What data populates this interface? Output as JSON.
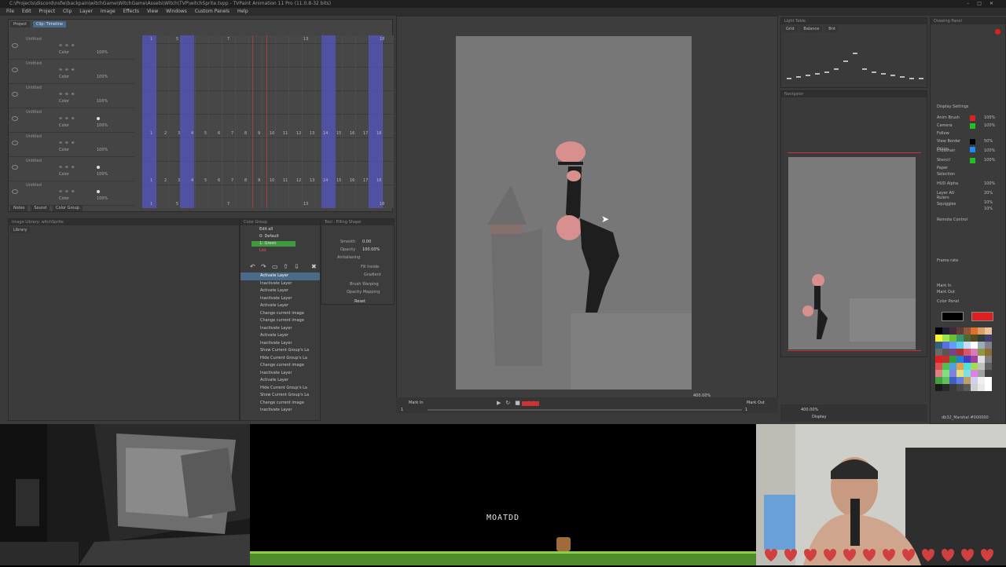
{
  "app": {
    "title": "C:\\Projects\\discord\\nsfw\\backpain\\witchGame\\WitchGame\\Assets\\Witch\\TVP\\witchSprite.tvpp - TVPaint Animation 11 Pro (11.0.8-32 bits)",
    "menu": [
      "File",
      "Edit",
      "Project",
      "Clip",
      "Layer",
      "Image",
      "Effects",
      "View",
      "Windows",
      "Custom Panels",
      "Help"
    ]
  },
  "timeline": {
    "tabs": [
      "Project",
      "Clip: Timeline"
    ],
    "layers": [
      {
        "name": "Untitled",
        "tool": "∞ ∞ ∞",
        "color": "Color",
        "opacity": "100%"
      },
      {
        "name": "Untitled",
        "tool": "∞ ∞ ∞",
        "color": "Color",
        "opacity": "100%"
      },
      {
        "name": "Untitled",
        "tool": "∞ ∞ ∞",
        "color": "Color",
        "opacity": "100%"
      },
      {
        "name": "Untitled",
        "tool": "∞ ∞ ∞",
        "color": "Color",
        "opacity": "100%"
      },
      {
        "name": "Untitled",
        "tool": "∞ ∞ ∞",
        "color": "Color",
        "opacity": "100%"
      },
      {
        "name": "Untitled",
        "tool": "∞ ∞ ∞",
        "color": "Color",
        "opacity": "100%"
      },
      {
        "name": "Untitled",
        "tool": "∞ ∞ ∞",
        "color": "Color",
        "opacity": "100%"
      }
    ],
    "ruler_top": [
      "1",
      "5",
      "7",
      "13",
      "18"
    ],
    "ruler_row": [
      "1",
      "2",
      "3",
      "4",
      "5",
      "6",
      "7",
      "8",
      "9",
      "10",
      "11",
      "12",
      "13",
      "14",
      "15",
      "16",
      "17",
      "18"
    ],
    "bottom_tabs": [
      "Notes",
      "Sound",
      "Color Group"
    ]
  },
  "library": {
    "tabs": [
      "Library",
      "Image Library: witchSprite"
    ]
  },
  "color_group": {
    "header": "Color Group",
    "items": [
      "Edit all",
      "0: Default",
      "1: Green",
      "List"
    ]
  },
  "history": {
    "items": [
      "Activate Layer",
      "Inactivate Layer",
      "Activate Layer",
      "Inactivate Layer",
      "Activate Layer",
      "Change current image",
      "Change current image",
      "Inactivate Layer",
      "Activate Layer",
      "Inactivate Layer",
      "Show Current Group's La",
      "Hide Current Group's La",
      "Change current image",
      "Inactivate Layer",
      "Activate Layer",
      "Hide Current Group's La",
      "Show Current Group's La",
      "Change current image",
      "Inactivate Layer"
    ]
  },
  "tool_options": {
    "header": "Tool : Filling Shape",
    "rows": [
      "Smooth",
      "Opacity",
      "Antialiasing",
      "Fill Inside",
      "Gradient",
      "Brush Warping",
      "Opacity Mapping",
      "Reset"
    ],
    "smooth_value": "0.00",
    "opacity_value": "100.00%"
  },
  "viewport": {
    "zoom": "400.00%",
    "mark_in": "Mark In",
    "mark_out": "Mark Out",
    "frame_start": "1",
    "frame_end": "1"
  },
  "light_table": {
    "header": "Light Table",
    "tabs": [
      "Grid",
      "Balance",
      "Bnt"
    ]
  },
  "navigator": {
    "header": "Navigator",
    "zoom": "400.00%",
    "display": "Display"
  },
  "drawing_panel": {
    "header": "Drawing Panel",
    "display_settings": [
      "Display Settings",
      "Anim Brush",
      "Camera",
      "Follow",
      "View Border",
      "Onion",
      "Crosshair",
      "Stencil",
      "Paper",
      "Selection",
      "HUD Alpha",
      "Layer Alt",
      "Rulers",
      "Squiggles"
    ],
    "display_values": [
      "100%",
      "100%",
      "",
      "50%",
      "",
      "100%",
      "100%",
      "",
      "",
      "100%",
      "20%",
      "10%",
      "10%"
    ],
    "remote_control": "Remote Control",
    "frame_rate": "Frame rate",
    "mark_in": "Mark In",
    "mark_out": "Mark Out",
    "color_panel": "Color Panel",
    "status": "db32_Marshal #000000"
  },
  "game": {
    "title": "MOATDD"
  },
  "colors": {
    "frame_highlight": "#5858d2",
    "skin": "#d8908e",
    "figure": "#1e1e1e",
    "ground": "#4f8a2c",
    "red": "#e02020"
  }
}
